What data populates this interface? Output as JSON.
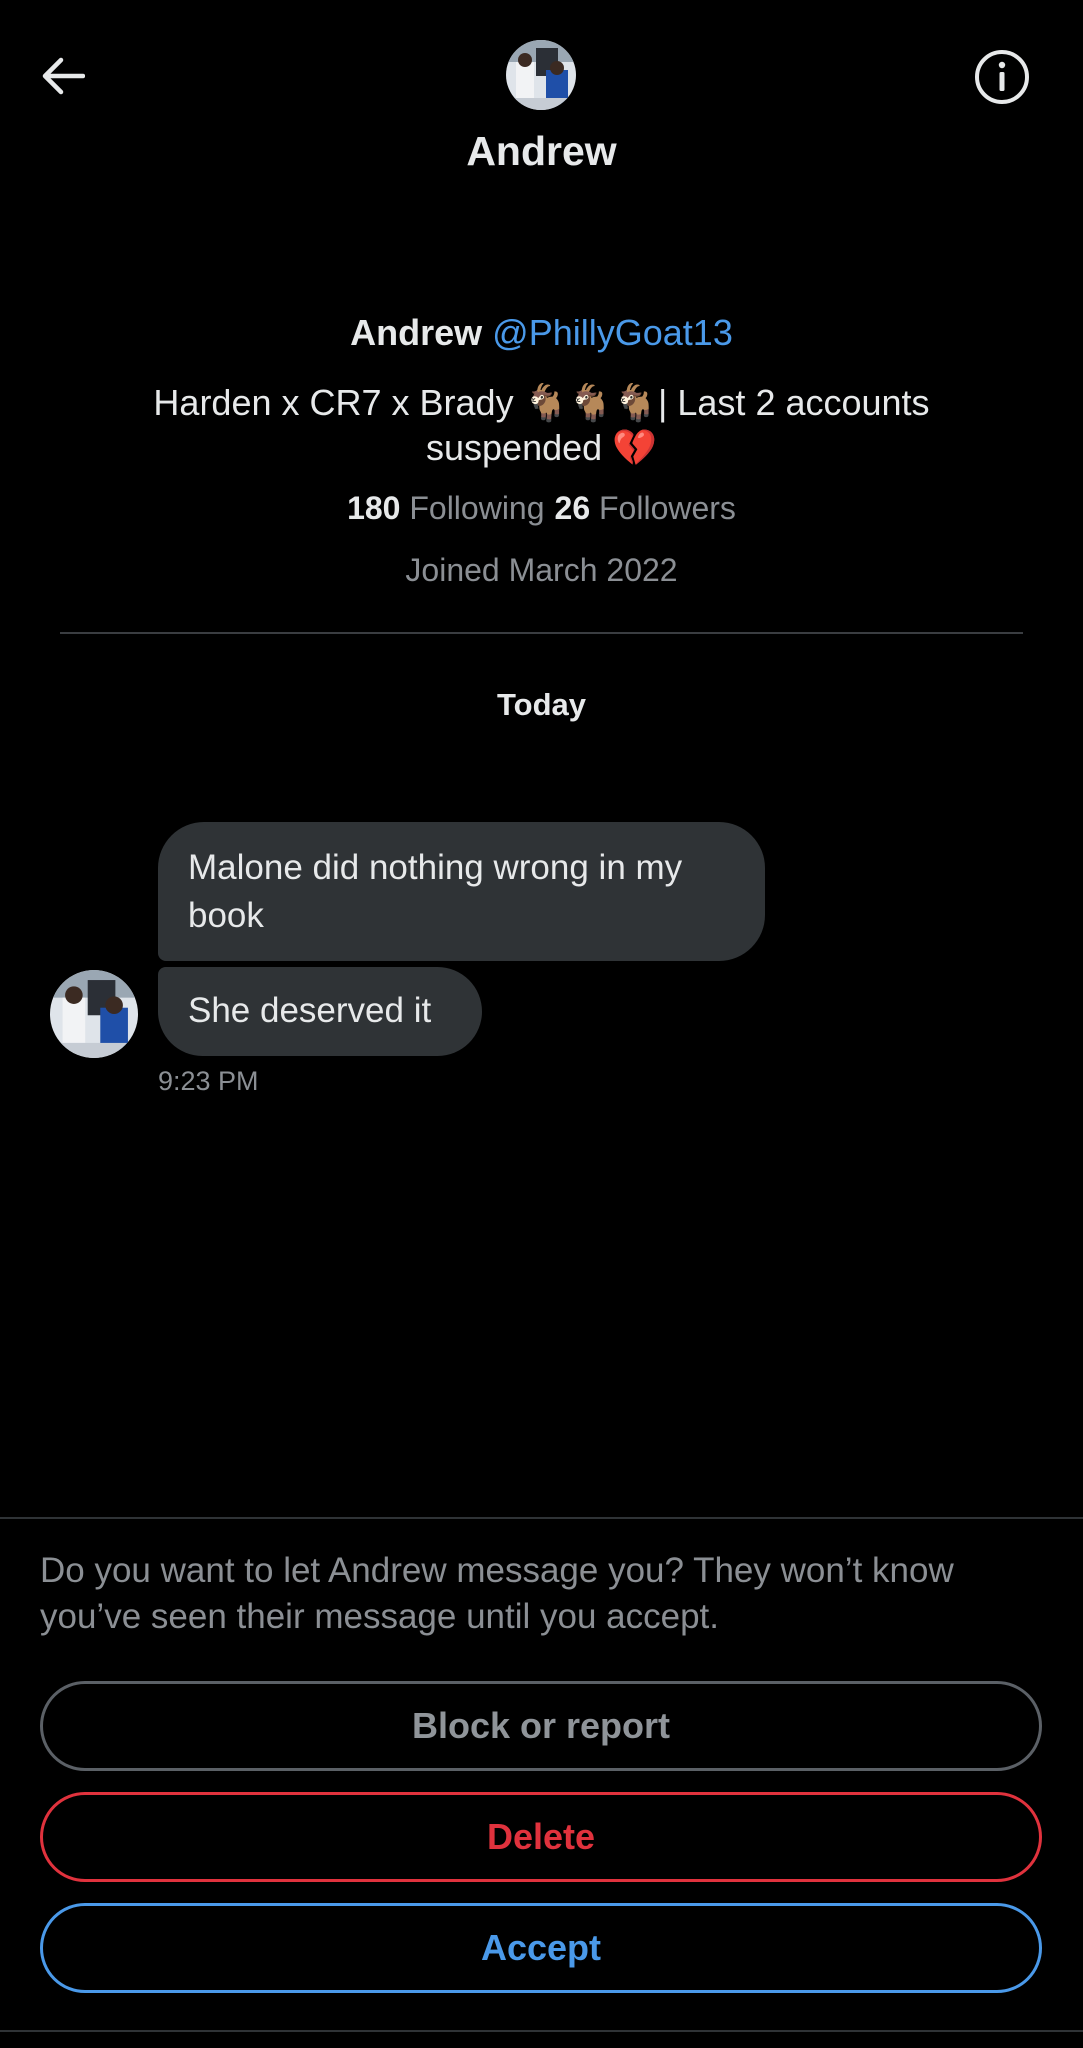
{
  "header": {
    "title": "Andrew",
    "back_icon": "arrow-left-icon",
    "info_icon": "info-icon"
  },
  "profile": {
    "name": "Andrew",
    "handle": "@PhillyGoat13",
    "bio": "Harden x CR7 x Brady 🐐🐐🐐| Last 2 accounts suspended 💔",
    "following_count": "180",
    "following_label": "Following",
    "followers_count": "26",
    "followers_label": "Followers",
    "joined": "Joined March 2022"
  },
  "conversation": {
    "date_label": "Today",
    "messages": [
      {
        "text": "Malone did nothing wrong in my book"
      },
      {
        "text": "She deserved it"
      }
    ],
    "timestamp": "9:23 PM"
  },
  "request": {
    "prompt": "Do you want to let Andrew message you? They won’t know you’ve seen their message until you accept.",
    "block_label": "Block or report",
    "delete_label": "Delete",
    "accept_label": "Accept"
  },
  "colors": {
    "background": "#000000",
    "bubble": "#2f3336",
    "link": "#4a99e9",
    "danger": "#e0323d",
    "muted": "#8b8f94"
  }
}
